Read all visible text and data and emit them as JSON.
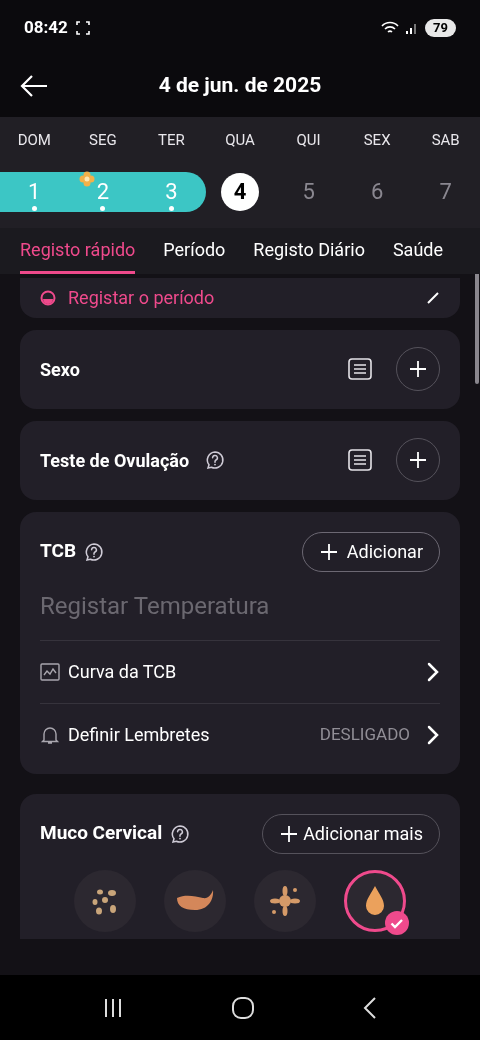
{
  "status_bar": {
    "time": "08:42",
    "battery": "79"
  },
  "header": {
    "title": "4 de jun. de 2025"
  },
  "weekdays": [
    "DOM",
    "SEG",
    "TER",
    "QUA",
    "QUI",
    "SEX",
    "SAB"
  ],
  "days": [
    {
      "label": "1",
      "period": true,
      "selected": false,
      "dot": true,
      "badge": false
    },
    {
      "label": "2",
      "period": true,
      "selected": false,
      "dot": true,
      "badge": true
    },
    {
      "label": "3",
      "period": true,
      "selected": false,
      "dot": true,
      "badge": false
    },
    {
      "label": "4",
      "period": false,
      "selected": true,
      "dot": false,
      "badge": false
    },
    {
      "label": "5",
      "period": false,
      "selected": false,
      "dot": false,
      "badge": false
    },
    {
      "label": "6",
      "period": false,
      "selected": false,
      "dot": false,
      "badge": false
    },
    {
      "label": "7",
      "period": false,
      "selected": false,
      "dot": false,
      "badge": false
    }
  ],
  "tabs": [
    {
      "label": "Registo rápido",
      "selected": true
    },
    {
      "label": "Período",
      "selected": false
    },
    {
      "label": "Registo Diário",
      "selected": false
    },
    {
      "label": "Saúde",
      "selected": false
    }
  ],
  "period_card": {
    "label": "Registar o período"
  },
  "simple_cards": [
    {
      "title": "Sexo",
      "help": false
    },
    {
      "title": "Teste de Ovulação",
      "help": true
    }
  ],
  "tcb": {
    "title": "TCB",
    "add_button": "Adicionar",
    "placeholder": "Registar Temperatura",
    "rows": [
      {
        "kind": "chart",
        "label": "Curva da TCB"
      },
      {
        "kind": "reminder",
        "label": "Definir Lembretes",
        "value": "DESLIGADO"
      }
    ]
  },
  "mucus": {
    "title": "Muco Cervical",
    "add_button": "Adicionar mais",
    "options": [
      {
        "kind": "dry",
        "selected": false
      },
      {
        "kind": "creamy",
        "selected": false
      },
      {
        "kind": "sticky",
        "selected": false
      },
      {
        "kind": "watery",
        "selected": true
      }
    ]
  }
}
